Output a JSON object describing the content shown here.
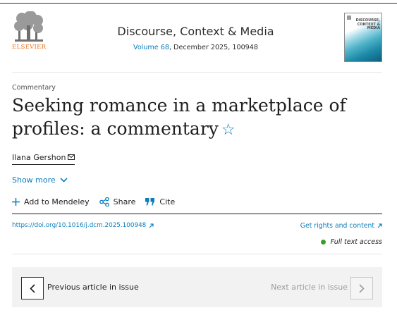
{
  "header": {
    "publisher": "ELSEVIER",
    "journal_title": "Discourse, Context & Media",
    "volume_link": "Volume 68",
    "issue_rest": ", December 2025, 100948",
    "cover_text": "DISCOURSE, CONTEXT & MEDIA"
  },
  "article": {
    "type": "Commentary",
    "title": "Seeking romance in a marketplace of profiles: a commentary",
    "star": "☆",
    "author": "Ilana Gershon",
    "show_more": "Show more"
  },
  "actions": {
    "mendeley": "Add to Mendeley",
    "share": "Share",
    "cite": "Cite"
  },
  "links": {
    "doi": "https://doi.org/10.1016/j.dcm.2025.100948",
    "rights": "Get rights and content",
    "access": "Full text access"
  },
  "navigation": {
    "previous": "Previous article in issue",
    "next": "Next article in issue"
  },
  "colors": {
    "link": "#0c7dbb",
    "publisher_orange": "#e9711c",
    "access_green": "#33a02c",
    "nav_background": "#f2f2f2"
  },
  "icons": [
    "elsevier-tree-logo",
    "star-icon",
    "mail-icon",
    "chevron-down-icon",
    "plus-icon",
    "share-icon",
    "quote-icon",
    "external-link-icon",
    "chevron-left-icon",
    "chevron-right-icon"
  ]
}
